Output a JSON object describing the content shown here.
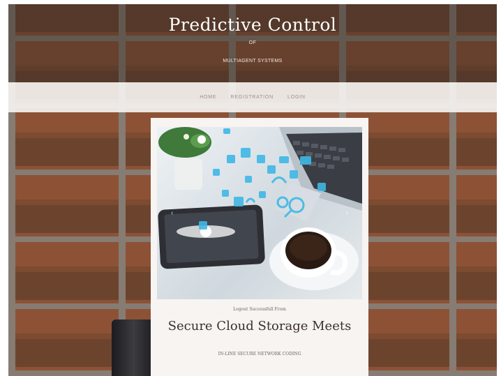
{
  "header": {
    "title": "Predictive Control",
    "of": "OF",
    "subtitle": "MULTIAGENT SYSTEMS"
  },
  "nav": {
    "items": [
      {
        "label": "HOME"
      },
      {
        "label": "REGISTRATION"
      },
      {
        "label": "LOGIN"
      }
    ]
  },
  "slide": {
    "arrow_prev": "‹",
    "arrow_next": "›",
    "small_caption": "Logout Successfull From",
    "title": "Secure Cloud Storage Meets",
    "subtitle": "IN-LINE SECURE NETWORK CODING"
  },
  "colors": {
    "nav_bg": "#f5f2f0",
    "card_bg": "#f7f4f2",
    "icon_accent": "#3fb8e6"
  }
}
